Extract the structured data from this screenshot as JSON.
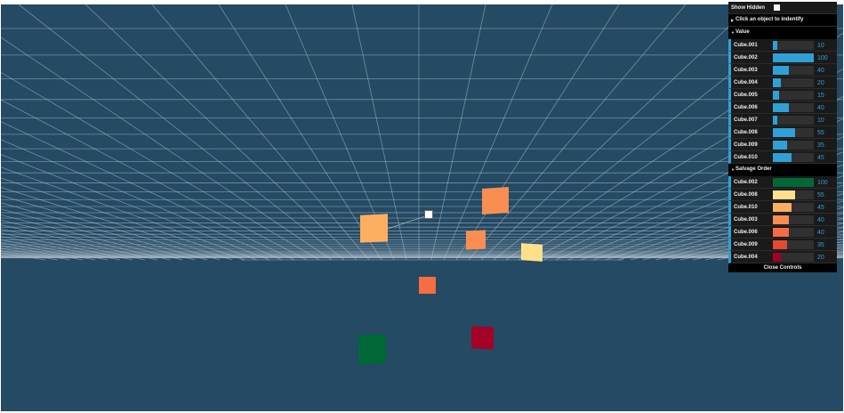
{
  "controls": {
    "show_hidden_label": "Show Hidden",
    "show_hidden_checked": false,
    "identify_hint": "Click an object to indentify",
    "close_label": "Close Controls"
  },
  "value_folder": {
    "title": "Value",
    "accent": "#2fa1d6",
    "items": [
      {
        "label": "Cube.001",
        "value": "10"
      },
      {
        "label": "Cube.002",
        "value": "100"
      },
      {
        "label": "Cube.003",
        "value": "40"
      },
      {
        "label": "Cube.004",
        "value": "20"
      },
      {
        "label": "Cube.005",
        "value": "15"
      },
      {
        "label": "Cube.006",
        "value": "40"
      },
      {
        "label": "Cube.007",
        "value": "10"
      },
      {
        "label": "Cube.008",
        "value": "55"
      },
      {
        "label": "Cube.009",
        "value": "35"
      },
      {
        "label": "Cube.010",
        "value": "45"
      }
    ]
  },
  "salvage_folder": {
    "title": "Salvage Order",
    "items": [
      {
        "label": "Cube.002",
        "value": "100",
        "color": "#006837"
      },
      {
        "label": "Cube.008",
        "value": "55",
        "color": "#fee08b"
      },
      {
        "label": "Cube.010",
        "value": "45",
        "color": "#fdae61"
      },
      {
        "label": "Cube.003",
        "value": "40",
        "color": "#f98e52"
      },
      {
        "label": "Cube.006",
        "value": "40",
        "color": "#f46d43"
      },
      {
        "label": "Cube.009",
        "value": "35",
        "color": "#e34a33"
      },
      {
        "label": "Cube.004",
        "value": "20",
        "color": "#a50026"
      }
    ]
  },
  "scene": {
    "background": "#244a64",
    "grid_color": "#b9c7d1"
  }
}
